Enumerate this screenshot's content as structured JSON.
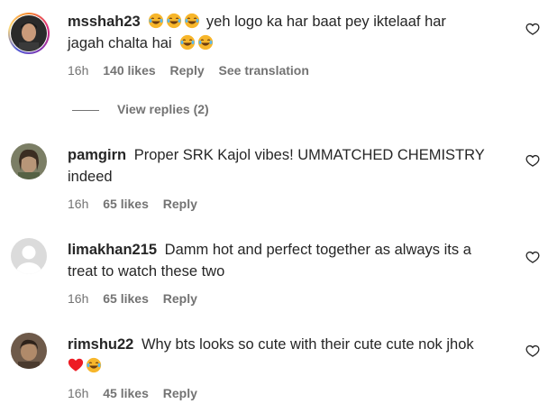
{
  "comments": [
    {
      "username": "msshah23",
      "text_before": "",
      "text": "yeh logo ka har baat pey iktelaaf har",
      "text_line2": "jagah chalta hai",
      "emojis_before": [
        "laughing-emoji",
        "laughing-emoji",
        "laughing-emoji"
      ],
      "emojis_after": [
        "laughing-emoji",
        "laughing-emoji"
      ],
      "time": "16h",
      "likes": "140 likes",
      "reply": "Reply",
      "translation": "See translation",
      "view_replies": "View replies (2)"
    },
    {
      "username": "pamgirn",
      "text": "Proper SRK Kajol vibes! UMMATCHED CHEMISTRY",
      "text_line2": "indeed",
      "time": "16h",
      "likes": "65 likes",
      "reply": "Reply"
    },
    {
      "username": "limakhan215",
      "text": "Damm hot and perfect together as always its a",
      "text_line2": "treat to watch these two",
      "time": "16h",
      "likes": "65 likes",
      "reply": "Reply"
    },
    {
      "username": "rimshu22",
      "text": "Why bts looks so cute with their cute cute nok jhok",
      "emojis_line2": [
        "red-heart-emoji",
        "laughing-emoji"
      ],
      "time": "16h",
      "likes": "45 likes",
      "reply": "Reply"
    }
  ],
  "colors": {
    "text": "#262626",
    "meta": "#737373",
    "heart_red": "#ed4956"
  }
}
